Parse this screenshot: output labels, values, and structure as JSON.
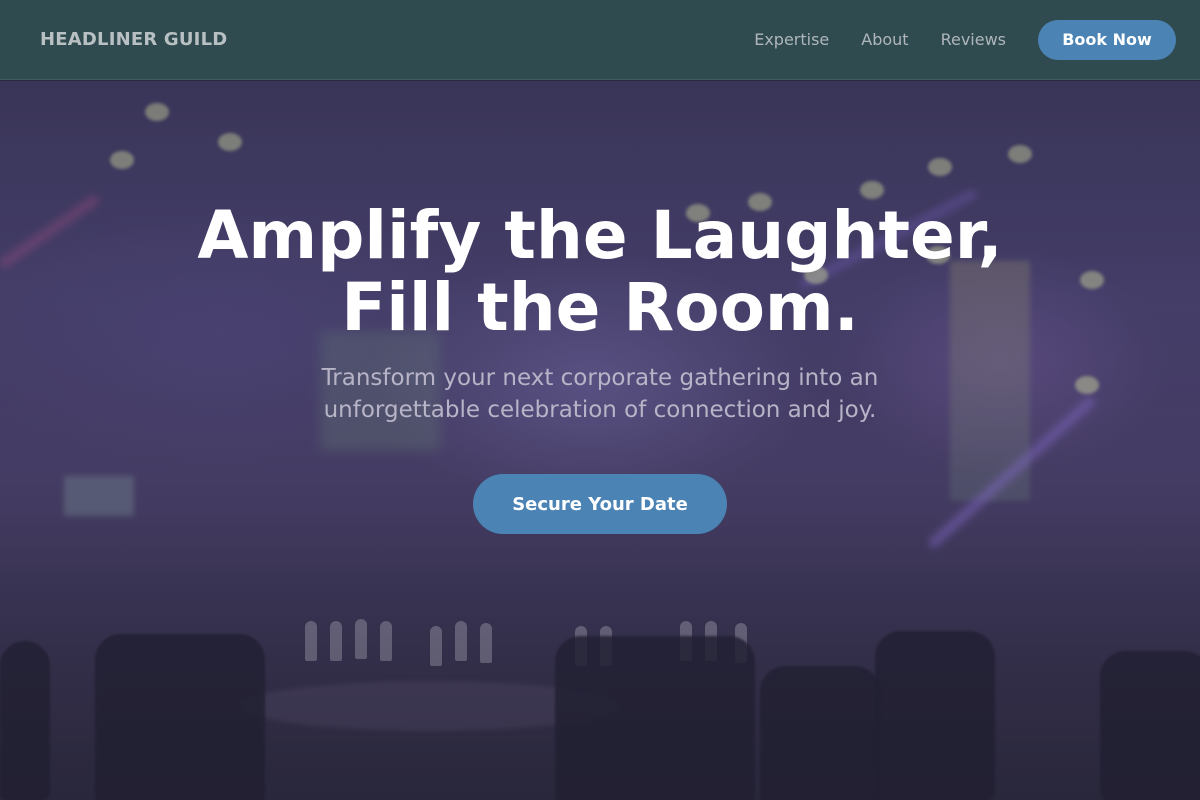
{
  "header": {
    "brand": "HEADLINER GUILD",
    "nav": [
      "Expertise",
      "About",
      "Reviews"
    ],
    "cta_label": "Book Now"
  },
  "hero": {
    "headline_line1": "Amplify the Laughter,",
    "headline_line2": "Fill the Room.",
    "subhead_line1": "Transform your next corporate gathering into an",
    "subhead_line2": "unforgettable celebration of connection and joy.",
    "cta_label": "Secure Your Date",
    "background_image": "event-venue-photo"
  },
  "colors": {
    "header_bg": "#2f4b4f",
    "accent": "#4a83b4",
    "brand_text": "#b8c0c3",
    "nav_text": "#aeb6bb"
  }
}
